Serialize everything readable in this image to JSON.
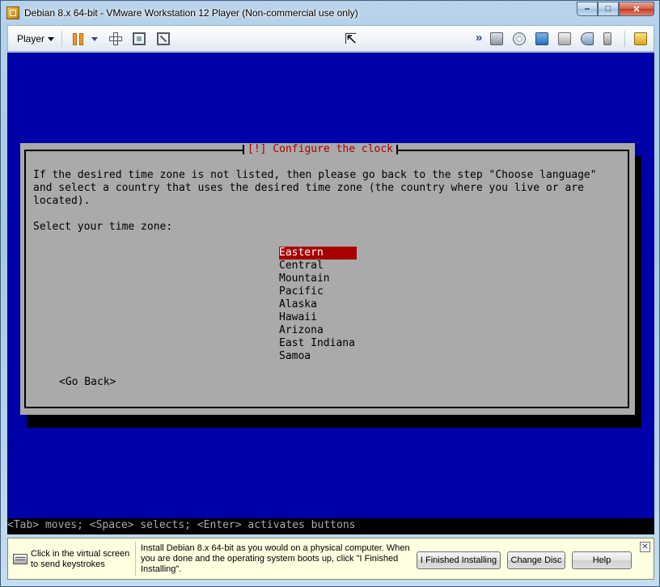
{
  "window": {
    "title": "Debian 8.x 64-bit - VMware Workstation 12 Player (Non-commercial use only)",
    "minimize": "‒",
    "maximize": "□",
    "close": "✕"
  },
  "toolbar": {
    "player_menu": "Player",
    "more_devices": "»"
  },
  "installer": {
    "dialog_title": "[!] Configure the clock",
    "message": "If the desired time zone is not listed, then please go back to the step \"Choose language\"\nand select a country that uses the desired time zone (the country where you live or are\nlocated).",
    "prompt": "Select your time zone:",
    "timezones": [
      "Eastern",
      "Central",
      "Mountain",
      "Pacific",
      "Alaska",
      "Hawaii",
      "Arizona",
      "East Indiana",
      "Samoa"
    ],
    "selected_index": 0,
    "go_back": "<Go Back>",
    "status_line": "<Tab> moves; <Space> selects; <Enter> activates buttons"
  },
  "hintbar": {
    "left_text": "Click in the virtual screen to send keystrokes",
    "main_text": "Install Debian 8.x 64-bit as you would on a physical computer. When you are done and the operating system boots up, click \"I Finished Installing\".",
    "finished_button": "I Finished Installing",
    "change_disc_button": "Change Disc",
    "help_button": "Help",
    "close": "✕"
  }
}
